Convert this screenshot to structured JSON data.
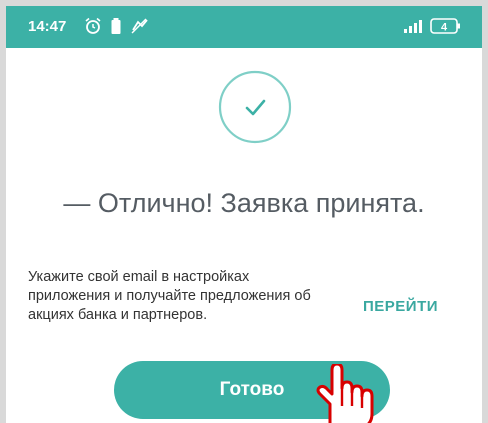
{
  "status_bar": {
    "time": "14:47",
    "battery_level": "4",
    "background_color": "#3cb1a6",
    "icons": [
      "alarm-icon",
      "battery-icon",
      "notification-icon",
      "signal-icon",
      "battery-indicator-icon"
    ]
  },
  "success": {
    "icon": "checkmark-icon",
    "title": "— Отлично! Заявка принята."
  },
  "promo": {
    "text": "Укажите свой email в настройках приложения и получайте предложения об акциях банка и партнеров.",
    "link_label": "ПЕРЕЙТИ",
    "link_color": "#3aa8a0"
  },
  "done_button": {
    "label": "Готово",
    "color": "#3cb1a6"
  },
  "overlay": {
    "icon": "hand-pointer-icon",
    "color": "#d80000"
  }
}
